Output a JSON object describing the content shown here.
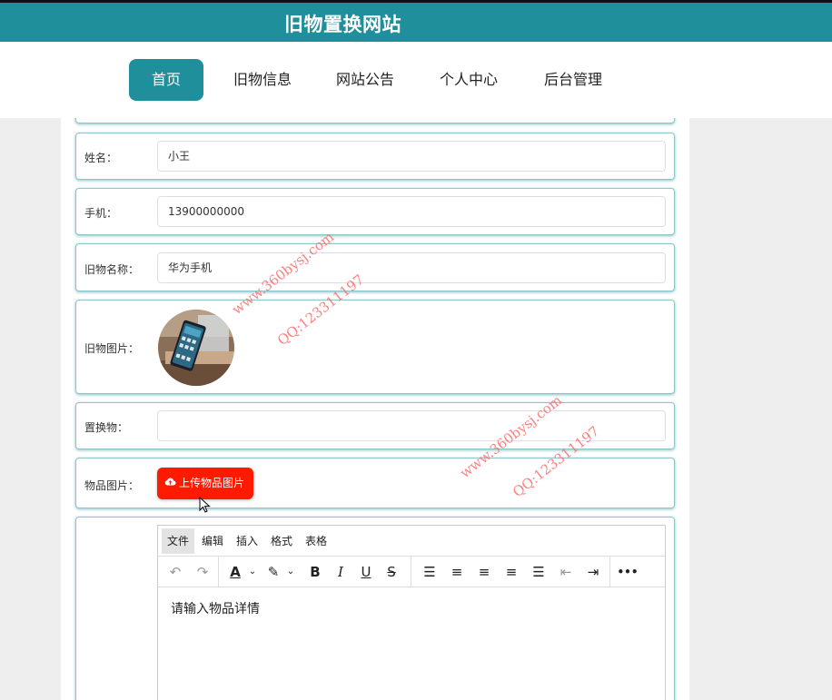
{
  "header": {
    "title": "旧物置换网站"
  },
  "nav": {
    "items": [
      {
        "label": "首页"
      },
      {
        "label": "旧物信息"
      },
      {
        "label": "网站公告"
      },
      {
        "label": "个人中心"
      },
      {
        "label": "后台管理"
      }
    ]
  },
  "form": {
    "name": {
      "label": "姓名：",
      "value": "小王"
    },
    "phone": {
      "label": "手机：",
      "value": "13900000000"
    },
    "item_name": {
      "label": "旧物名称：",
      "value": "华为手机"
    },
    "item_image": {
      "label": "旧物图片："
    },
    "exchange": {
      "label": "置换物：",
      "value": ""
    },
    "product_image": {
      "label": "物品图片：",
      "upload_label": "上传物品图片"
    },
    "details": {
      "placeholder": "请输入物品详情"
    }
  },
  "editor": {
    "menus": [
      "文件",
      "编辑",
      "插入",
      "格式",
      "表格"
    ],
    "more": "•••"
  },
  "watermark": {
    "site": "www.360bysj.com",
    "qq": "QQ:123311197"
  },
  "colors": {
    "brand": "#1e8f9b",
    "upload": "#ff1a00",
    "watermark": "#ff6b6b"
  }
}
